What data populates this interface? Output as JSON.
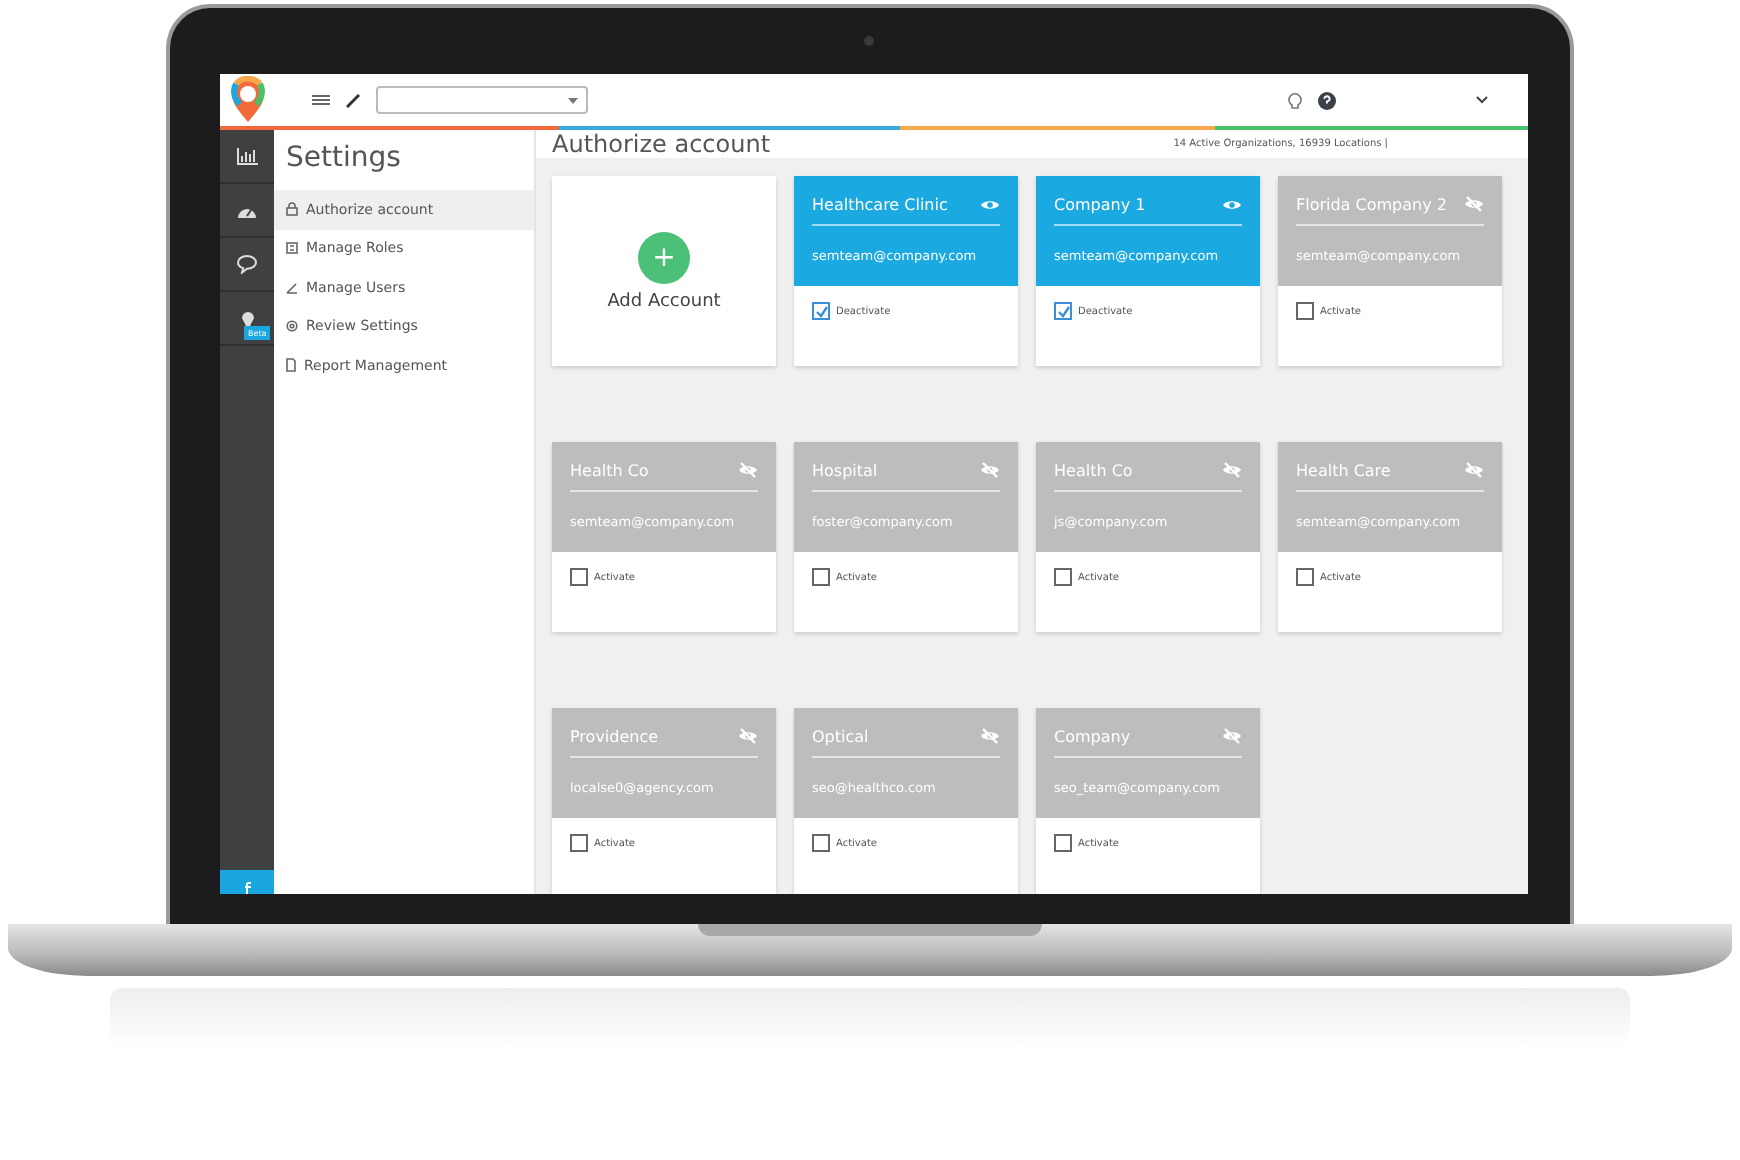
{
  "rail": {
    "items": [
      {
        "selected": false
      },
      {
        "selected": false
      },
      {
        "selected": false
      },
      {
        "selected": false,
        "badge": "Beta"
      }
    ]
  },
  "settings": {
    "title": "Settings",
    "items": [
      {
        "label": "Authorize account",
        "selected": true
      },
      {
        "label": "Manage Roles",
        "selected": false
      },
      {
        "label": "Manage Users",
        "selected": false
      },
      {
        "label": "Review Settings",
        "selected": false
      },
      {
        "label": "Report Management",
        "selected": false
      }
    ]
  },
  "main": {
    "title": "Authorize account",
    "summary": "14 Active Organizations, 16939 Locations  |"
  },
  "cards": [
    {
      "kind": "add",
      "label": "Add Account",
      "button": "+"
    },
    {
      "kind": "account",
      "name": "Healthcare Clinic",
      "email": "semteam@company.com",
      "active": true,
      "checked": true,
      "action": "Deactivate"
    },
    {
      "kind": "account",
      "name": "Company 1",
      "email": "semteam@company.com",
      "active": true,
      "checked": true,
      "action": "Deactivate"
    },
    {
      "kind": "account",
      "name": "Florida Company 2",
      "email": "semteam@company.com",
      "active": false,
      "checked": false,
      "action": "Activate"
    },
    {
      "kind": "account",
      "name": "Health Co",
      "email": "semteam@company.com",
      "active": false,
      "checked": false,
      "action": "Activate"
    },
    {
      "kind": "account",
      "name": "Hospital",
      "email": "foster@company.com",
      "active": false,
      "checked": false,
      "action": "Activate"
    },
    {
      "kind": "account",
      "name": "Health Co",
      "email": "js@company.com",
      "active": false,
      "checked": false,
      "action": "Activate"
    },
    {
      "kind": "account",
      "name": "Health Care",
      "email": "semteam@company.com",
      "active": false,
      "checked": false,
      "action": "Activate"
    },
    {
      "kind": "account",
      "name": "Providence",
      "email": "localse0@agency.com",
      "active": false,
      "checked": false,
      "action": "Activate"
    },
    {
      "kind": "account",
      "name": "Optical",
      "email": "seo@healthco.com",
      "active": false,
      "checked": false,
      "action": "Activate"
    },
    {
      "kind": "account",
      "name": "Company",
      "email": "seo_team@company.com",
      "active": false,
      "checked": false,
      "action": "Activate"
    }
  ]
}
